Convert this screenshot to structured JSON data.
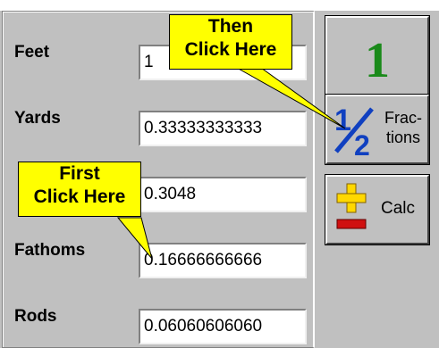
{
  "fields": [
    {
      "label": "Feet",
      "value": "1"
    },
    {
      "label": "Yards",
      "value": "0.33333333333"
    },
    {
      "label": "",
      "value": "0.3048"
    },
    {
      "label": "Fathoms",
      "value": "0.16666666666"
    },
    {
      "label": "Rods",
      "value": "0.06060606060"
    }
  ],
  "buttons": {
    "one": "1",
    "fractions_glyph": "½",
    "fractions_label_line1": "Frac-",
    "fractions_label_line2": "tions",
    "calc_label": "Calc"
  },
  "callouts": {
    "then_line1": "Then",
    "then_line2": "Click Here",
    "first_line1": "First",
    "first_line2": "Click Here"
  },
  "colors": {
    "callout": "#ffff00",
    "one_green": "#1a8a1a",
    "fraction_blue": "#1040c0",
    "plus_yellow": "#ffd800",
    "minus_red": "#d01010"
  }
}
